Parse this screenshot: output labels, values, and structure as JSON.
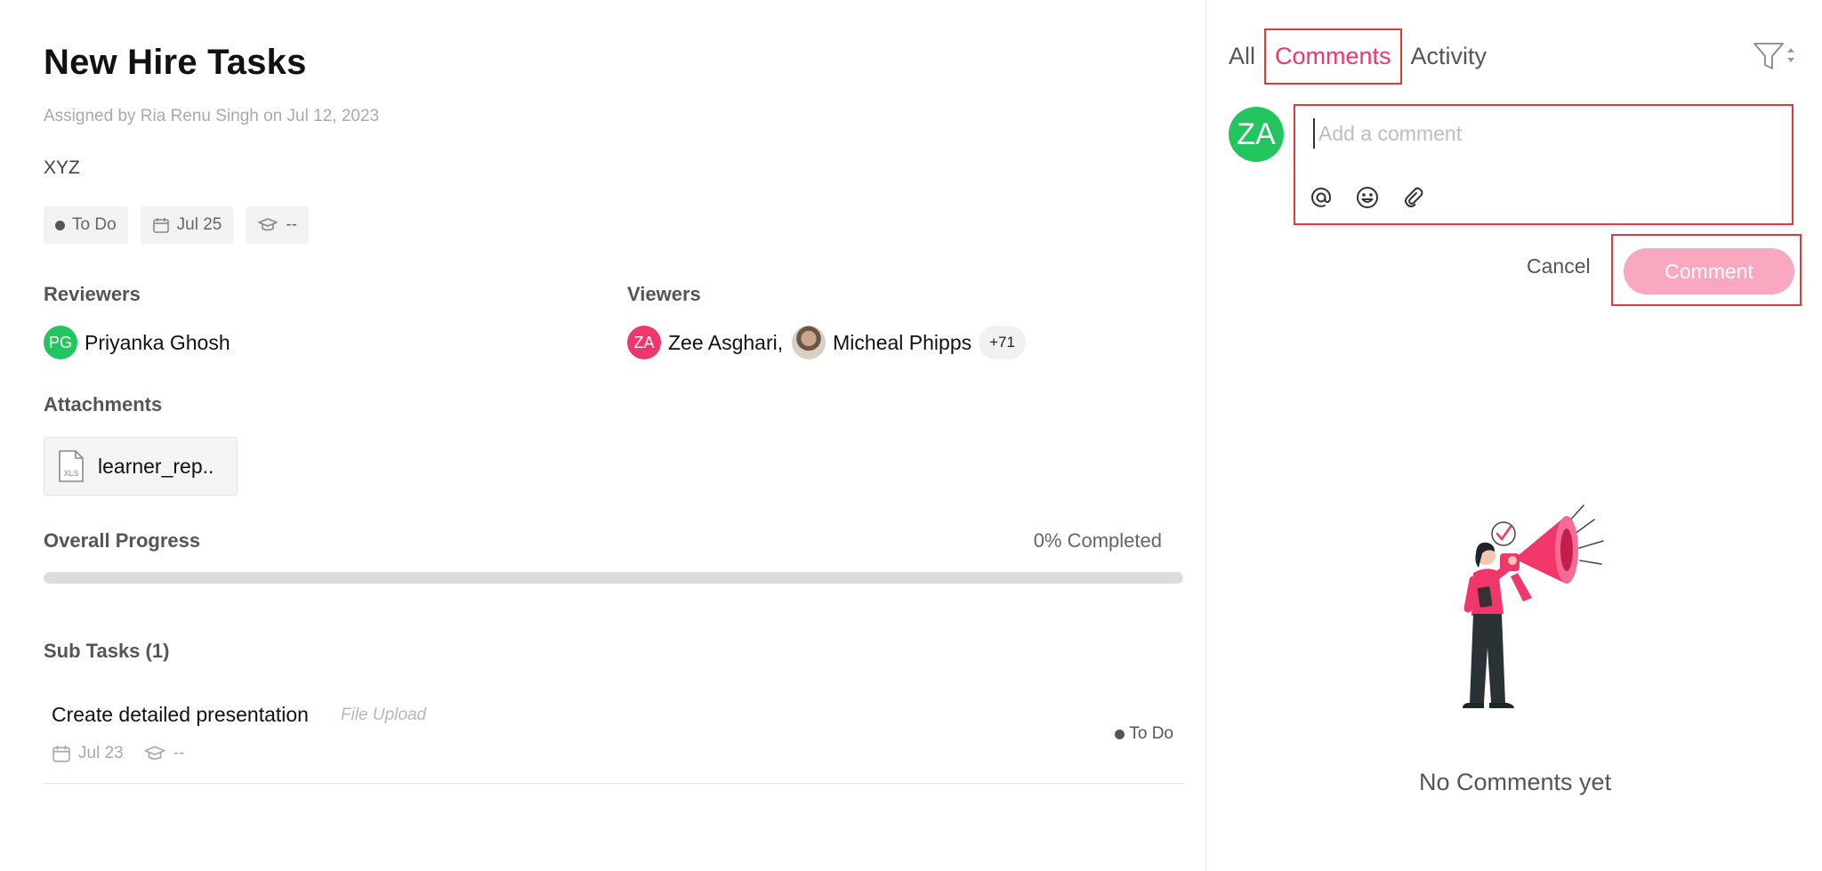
{
  "task": {
    "title": "New Hire Tasks",
    "assigned_text": "Assigned by Ria Renu Singh on  Jul 12, 2023",
    "description": "XYZ",
    "status": "To Do",
    "due_date": "Jul 25",
    "course": "--"
  },
  "reviewers": {
    "label": "Reviewers",
    "people": [
      {
        "initials": "PG",
        "name": "Priyanka Ghosh"
      }
    ]
  },
  "viewers": {
    "label": "Viewers",
    "people": [
      {
        "initials": "ZA",
        "name": "Zee Asghari,"
      },
      {
        "initials": "",
        "name": "Micheal Phipps"
      }
    ],
    "more": "+71"
  },
  "attachments": {
    "label": "Attachments",
    "files": [
      {
        "name": "learner_rep..",
        "type_badge": "XLS"
      }
    ]
  },
  "progress": {
    "label": "Overall Progress",
    "value_text": "0% Completed",
    "fraction": 0
  },
  "subtasks": {
    "label": "Sub Tasks (1)",
    "items": [
      {
        "title": "Create detailed presentation",
        "type": "File Upload",
        "date": "Jul 23",
        "course": "--",
        "status": "To Do"
      }
    ]
  },
  "comments_panel": {
    "tabs": [
      "All",
      "Comments",
      "Activity"
    ],
    "active_tab": "Comments",
    "user_initials": "ZA",
    "placeholder": "Add a comment",
    "cancel_label": "Cancel",
    "comment_label": "Comment",
    "empty_text": "No Comments yet"
  },
  "colors": {
    "accent": "#f0366b",
    "accent_light": "#f9a8c0",
    "green_avatar": "#22c55e"
  }
}
